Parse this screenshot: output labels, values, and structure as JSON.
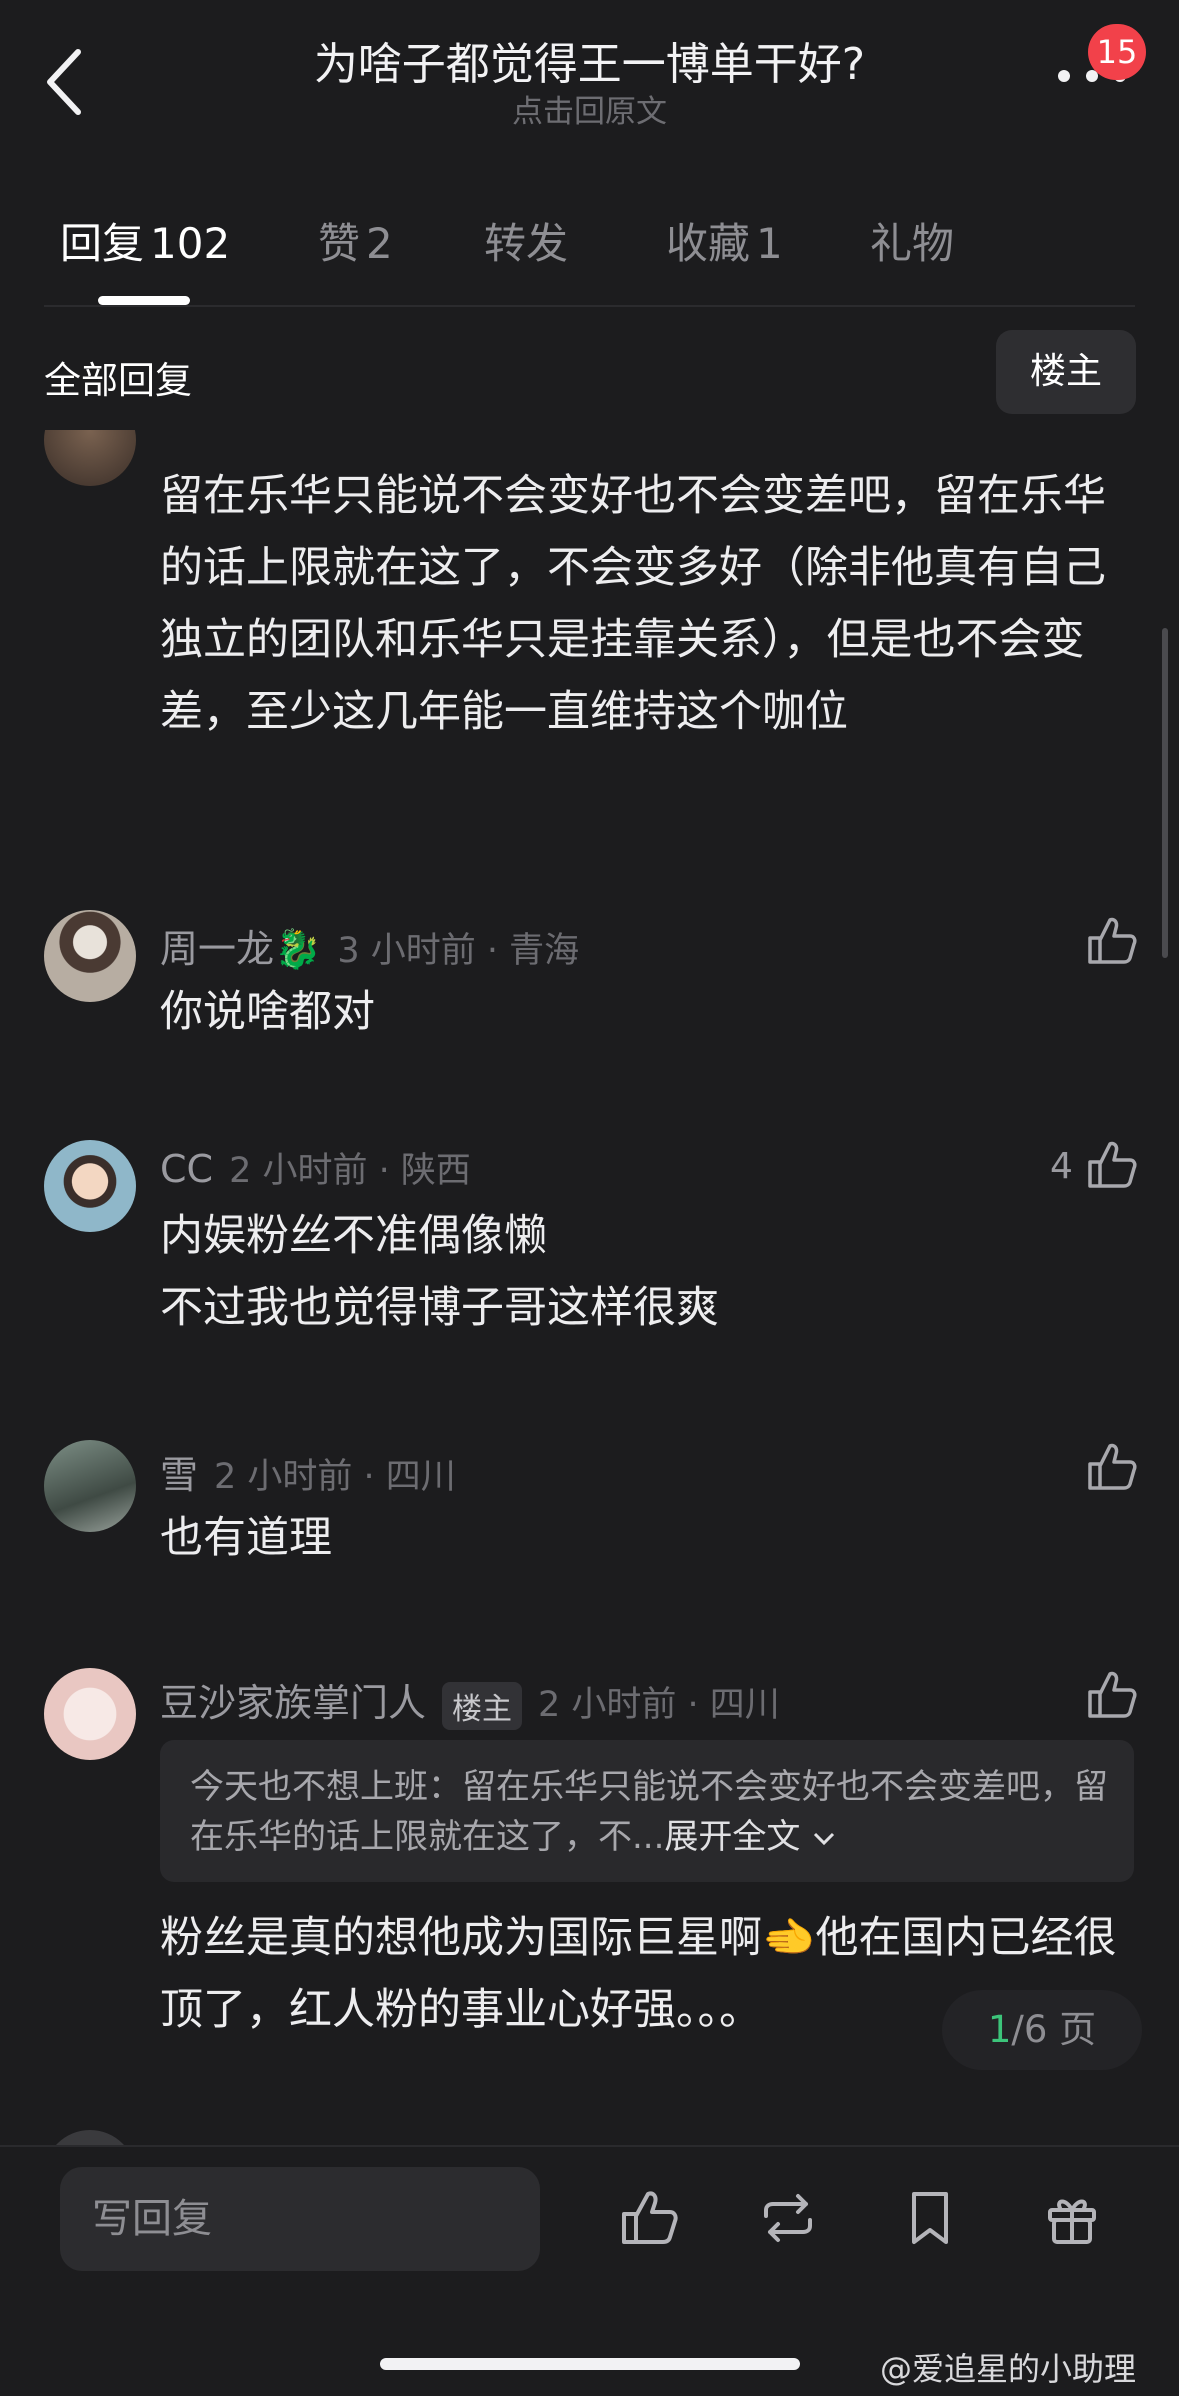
{
  "header": {
    "title": "为啥子都觉得王一博单干好?",
    "subtitle": "点击回原文",
    "badge": "15"
  },
  "tabs": [
    {
      "label": "回复",
      "count": "102"
    },
    {
      "label": "赞",
      "count": "2"
    },
    {
      "label": "转发",
      "count": ""
    },
    {
      "label": "收藏",
      "count": "1"
    },
    {
      "label": "礼物",
      "count": ""
    }
  ],
  "filter": {
    "label": "全部回复",
    "button": "楼主"
  },
  "comments": [
    {
      "content": "留在乐华只能说不会变好也不会变差吧，留在乐华的话上限就在这了，不会变多好（除非他真有自己独立的团队和乐华只是挂靠关系），但是也不会变差，至少这几年能一直维持这个咖位"
    },
    {
      "name": "周一龙🐉",
      "meta": "3 小时前 · 青海",
      "content": "你说啥都对"
    },
    {
      "name": "CC",
      "meta": "2 小时前 · 陕西",
      "likes": "4",
      "content_lines": [
        "内娱粉丝不准偶像懒",
        "不过我也觉得博子哥这样很爽"
      ]
    },
    {
      "name": "雪",
      "meta": "2 小时前 · 四川",
      "content": "也有道理"
    },
    {
      "name": "豆沙家族掌门人",
      "tag": "楼主",
      "meta": "2 小时前 · 四川",
      "quote": "今天也不想上班：留在乐华只能说不会变好也不会变差吧，留在乐华的话上限就在这了，不...",
      "quote_expand": "展开全文",
      "content": "粉丝是真的想他成为国际巨星啊🫲他在国内已经很顶了，红人粉的事业心好强。。。"
    }
  ],
  "pager": {
    "current": "1",
    "total": "/6 页"
  },
  "bottom": {
    "reply_placeholder": "写回复"
  },
  "watermark": "@爱追星的小助理",
  "colors": {
    "background": "#1c1c1e",
    "accent_green": "#3cc47a",
    "badge_red": "#f2414a"
  }
}
